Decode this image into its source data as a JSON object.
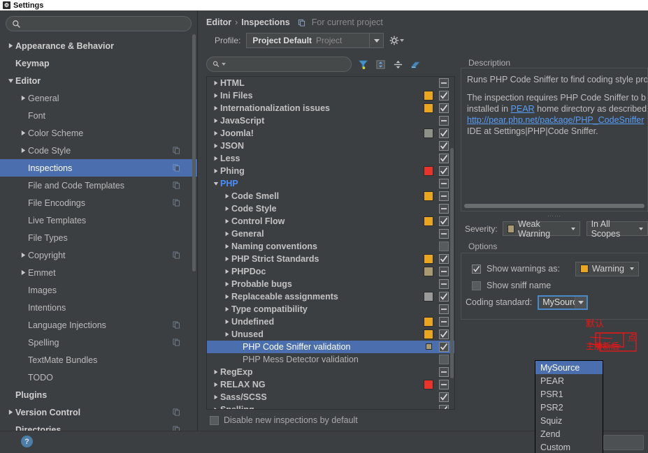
{
  "window": {
    "title": "Settings",
    "icon": "settings-window-icon"
  },
  "sidebar": {
    "search_placeholder": "",
    "search_value": "",
    "search_icon": "search-icon",
    "items": [
      {
        "label": "Appearance & Behavior",
        "indent": 0,
        "arrow": "right",
        "bold": true,
        "selected": false,
        "copy": false
      },
      {
        "label": "Keymap",
        "indent": 0,
        "arrow": "none",
        "bold": true,
        "selected": false,
        "copy": false
      },
      {
        "label": "Editor",
        "indent": 0,
        "arrow": "down",
        "bold": true,
        "selected": false,
        "copy": false
      },
      {
        "label": "General",
        "indent": 1,
        "arrow": "right",
        "bold": false,
        "selected": false,
        "copy": false
      },
      {
        "label": "Font",
        "indent": 1,
        "arrow": "none",
        "bold": false,
        "selected": false,
        "copy": false
      },
      {
        "label": "Color Scheme",
        "indent": 1,
        "arrow": "right",
        "bold": false,
        "selected": false,
        "copy": false
      },
      {
        "label": "Code Style",
        "indent": 1,
        "arrow": "right",
        "bold": false,
        "selected": false,
        "copy": true
      },
      {
        "label": "Inspections",
        "indent": 1,
        "arrow": "none",
        "bold": false,
        "selected": true,
        "copy": true
      },
      {
        "label": "File and Code Templates",
        "indent": 1,
        "arrow": "none",
        "bold": false,
        "selected": false,
        "copy": true
      },
      {
        "label": "File Encodings",
        "indent": 1,
        "arrow": "none",
        "bold": false,
        "selected": false,
        "copy": true
      },
      {
        "label": "Live Templates",
        "indent": 1,
        "arrow": "none",
        "bold": false,
        "selected": false,
        "copy": false
      },
      {
        "label": "File Types",
        "indent": 1,
        "arrow": "none",
        "bold": false,
        "selected": false,
        "copy": false
      },
      {
        "label": "Copyright",
        "indent": 1,
        "arrow": "right",
        "bold": false,
        "selected": false,
        "copy": true
      },
      {
        "label": "Emmet",
        "indent": 1,
        "arrow": "right",
        "bold": false,
        "selected": false,
        "copy": false
      },
      {
        "label": "Images",
        "indent": 1,
        "arrow": "none",
        "bold": false,
        "selected": false,
        "copy": false
      },
      {
        "label": "Intentions",
        "indent": 1,
        "arrow": "none",
        "bold": false,
        "selected": false,
        "copy": false
      },
      {
        "label": "Language Injections",
        "indent": 1,
        "arrow": "none",
        "bold": false,
        "selected": false,
        "copy": true
      },
      {
        "label": "Spelling",
        "indent": 1,
        "arrow": "none",
        "bold": false,
        "selected": false,
        "copy": true
      },
      {
        "label": "TextMate Bundles",
        "indent": 1,
        "arrow": "none",
        "bold": false,
        "selected": false,
        "copy": false
      },
      {
        "label": "TODO",
        "indent": 1,
        "arrow": "none",
        "bold": false,
        "selected": false,
        "copy": false
      },
      {
        "label": "Plugins",
        "indent": 0,
        "arrow": "none",
        "bold": true,
        "selected": false,
        "copy": false
      },
      {
        "label": "Version Control",
        "indent": 0,
        "arrow": "right",
        "bold": true,
        "selected": false,
        "copy": true
      },
      {
        "label": "Directories",
        "indent": 0,
        "arrow": "none",
        "bold": true,
        "selected": false,
        "copy": true
      }
    ]
  },
  "breadcrumb": {
    "parent": "Editor",
    "separator": "›",
    "current": "Inspections",
    "scope_icon": "copy-icon",
    "scope": "For current project"
  },
  "profile": {
    "label": "Profile:",
    "value": "Project Default",
    "value_suffix": "Project",
    "dropdown_icon": "chevron-down-icon",
    "gear_icon": "gear-dropdown-icon"
  },
  "inspections_toolbar": {
    "search_value": "",
    "search_icon": "search-dropdown-icon",
    "buttons": [
      {
        "name": "filter-icon",
        "title": "Filter inspections"
      },
      {
        "name": "expand-all-icon",
        "title": "Expand all"
      },
      {
        "name": "collapse-all-icon",
        "title": "Collapse all"
      },
      {
        "name": "reset-icon",
        "title": "Reset to defaults"
      }
    ]
  },
  "colors": {
    "warning": "#E9A621",
    "error": "#E8352B",
    "weak_warning": "#A99A73",
    "server_problem": "#8D9187",
    "typo": "#9A9A9A",
    "accent": "#4B6EAF",
    "link": "#589DF6",
    "annotation_red": "#F01414"
  },
  "inspections_tree": [
    {
      "label": "HTML",
      "indent": 0,
      "arrow": "right",
      "swatch": null,
      "check": "mixed"
    },
    {
      "label": "Ini Files",
      "indent": 0,
      "arrow": "right",
      "swatch": "#E9A621",
      "check": "on"
    },
    {
      "label": "Internationalization issues",
      "indent": 0,
      "arrow": "right",
      "swatch": "#E9A621",
      "check": "on"
    },
    {
      "label": "JavaScript",
      "indent": 0,
      "arrow": "right",
      "swatch": null,
      "check": "mixed"
    },
    {
      "label": "Joomla!",
      "indent": 0,
      "arrow": "right",
      "swatch": "#8D9187",
      "check": "on"
    },
    {
      "label": "JSON",
      "indent": 0,
      "arrow": "right",
      "swatch": null,
      "check": "on"
    },
    {
      "label": "Less",
      "indent": 0,
      "arrow": "right",
      "swatch": null,
      "check": "on"
    },
    {
      "label": "Phing",
      "indent": 0,
      "arrow": "right",
      "swatch": "#E8352B",
      "check": "on"
    },
    {
      "label": "PHP",
      "indent": 0,
      "arrow": "down",
      "swatch": null,
      "check": "mixed",
      "style": "php"
    },
    {
      "label": "Code Smell",
      "indent": 1,
      "arrow": "right",
      "swatch": "#E9A621",
      "check": "mixed"
    },
    {
      "label": "Code Style",
      "indent": 1,
      "arrow": "right",
      "swatch": null,
      "check": "mixed"
    },
    {
      "label": "Control Flow",
      "indent": 1,
      "arrow": "right",
      "swatch": "#E9A621",
      "check": "on"
    },
    {
      "label": "General",
      "indent": 1,
      "arrow": "right",
      "swatch": null,
      "check": "mixed"
    },
    {
      "label": "Naming conventions",
      "indent": 1,
      "arrow": "right",
      "swatch": null,
      "check": "off"
    },
    {
      "label": "PHP Strict Standards",
      "indent": 1,
      "arrow": "right",
      "swatch": "#E9A621",
      "check": "on"
    },
    {
      "label": "PHPDoc",
      "indent": 1,
      "arrow": "right",
      "swatch": "#A99A73",
      "check": "mixed"
    },
    {
      "label": "Probable bugs",
      "indent": 1,
      "arrow": "right",
      "swatch": null,
      "check": "mixed"
    },
    {
      "label": "Replaceable assignments",
      "indent": 1,
      "arrow": "right",
      "swatch": "#9A9A9A",
      "check": "on"
    },
    {
      "label": "Type compatibility",
      "indent": 1,
      "arrow": "right",
      "swatch": null,
      "check": "mixed"
    },
    {
      "label": "Undefined",
      "indent": 1,
      "arrow": "right",
      "swatch": "#E9A621",
      "check": "mixed"
    },
    {
      "label": "Unused",
      "indent": 1,
      "arrow": "right",
      "swatch": "#E9A621",
      "check": "on"
    },
    {
      "label": "PHP Code Sniffer validation",
      "indent": 2,
      "arrow": "none",
      "swatch": "#A99A73",
      "check": "on",
      "selected": true,
      "leaf": true
    },
    {
      "label": "PHP Mess Detector validation",
      "indent": 2,
      "arrow": "none",
      "swatch": null,
      "check": "off",
      "leaf": true
    },
    {
      "label": "RegExp",
      "indent": 0,
      "arrow": "right",
      "swatch": null,
      "check": "mixed"
    },
    {
      "label": "RELAX NG",
      "indent": 0,
      "arrow": "right",
      "swatch": "#E8352B",
      "check": "mixed"
    },
    {
      "label": "Sass/SCSS",
      "indent": 0,
      "arrow": "right",
      "swatch": null,
      "check": "on"
    },
    {
      "label": "Spelling",
      "indent": 0,
      "arrow": "right",
      "swatch": null,
      "check": "on"
    }
  ],
  "disable_new": {
    "label": "Disable new inspections by default",
    "checked": "off"
  },
  "description": {
    "title": "Description",
    "lines": [
      "Runs PHP Code Sniffer to find coding style pro",
      "",
      "The inspection requires PHP Code Sniffer to b",
      "installed in PEAR home directory as described",
      "http://pear.php.net/package/PHP_CodeSniffer",
      "IDE at Settings|PHP|Code Sniffer."
    ],
    "link_inline": "PEAR",
    "link_url": "http://pear.php.net/package/PHP_CodeSniffer"
  },
  "severity": {
    "label": "Severity:",
    "value": "Weak Warning",
    "swatch": "#A99A73",
    "scope_value": "In All Scopes",
    "dropdown_icon": "chevron-down-icon"
  },
  "options": {
    "title": "Options",
    "show_warnings": {
      "label": "Show warnings as:",
      "checked": "on",
      "value": "Warning",
      "swatch": "#E9A621"
    },
    "show_sniff_name": {
      "label": "Show sniff name",
      "checked": "off"
    },
    "coding_standard": {
      "label": "Coding standard:",
      "value": "MySource",
      "options": [
        "MySource",
        "PEAR",
        "PSR1",
        "PSR2",
        "Squiz",
        "Zend",
        "Custom"
      ],
      "selected_index": 0
    }
  },
  "annotation": {
    "note_top": "默认",
    "note_bottom": "主册新后",
    "note_right": "点"
  },
  "bottom": {
    "help_icon": "help-icon",
    "ok_label": ""
  }
}
